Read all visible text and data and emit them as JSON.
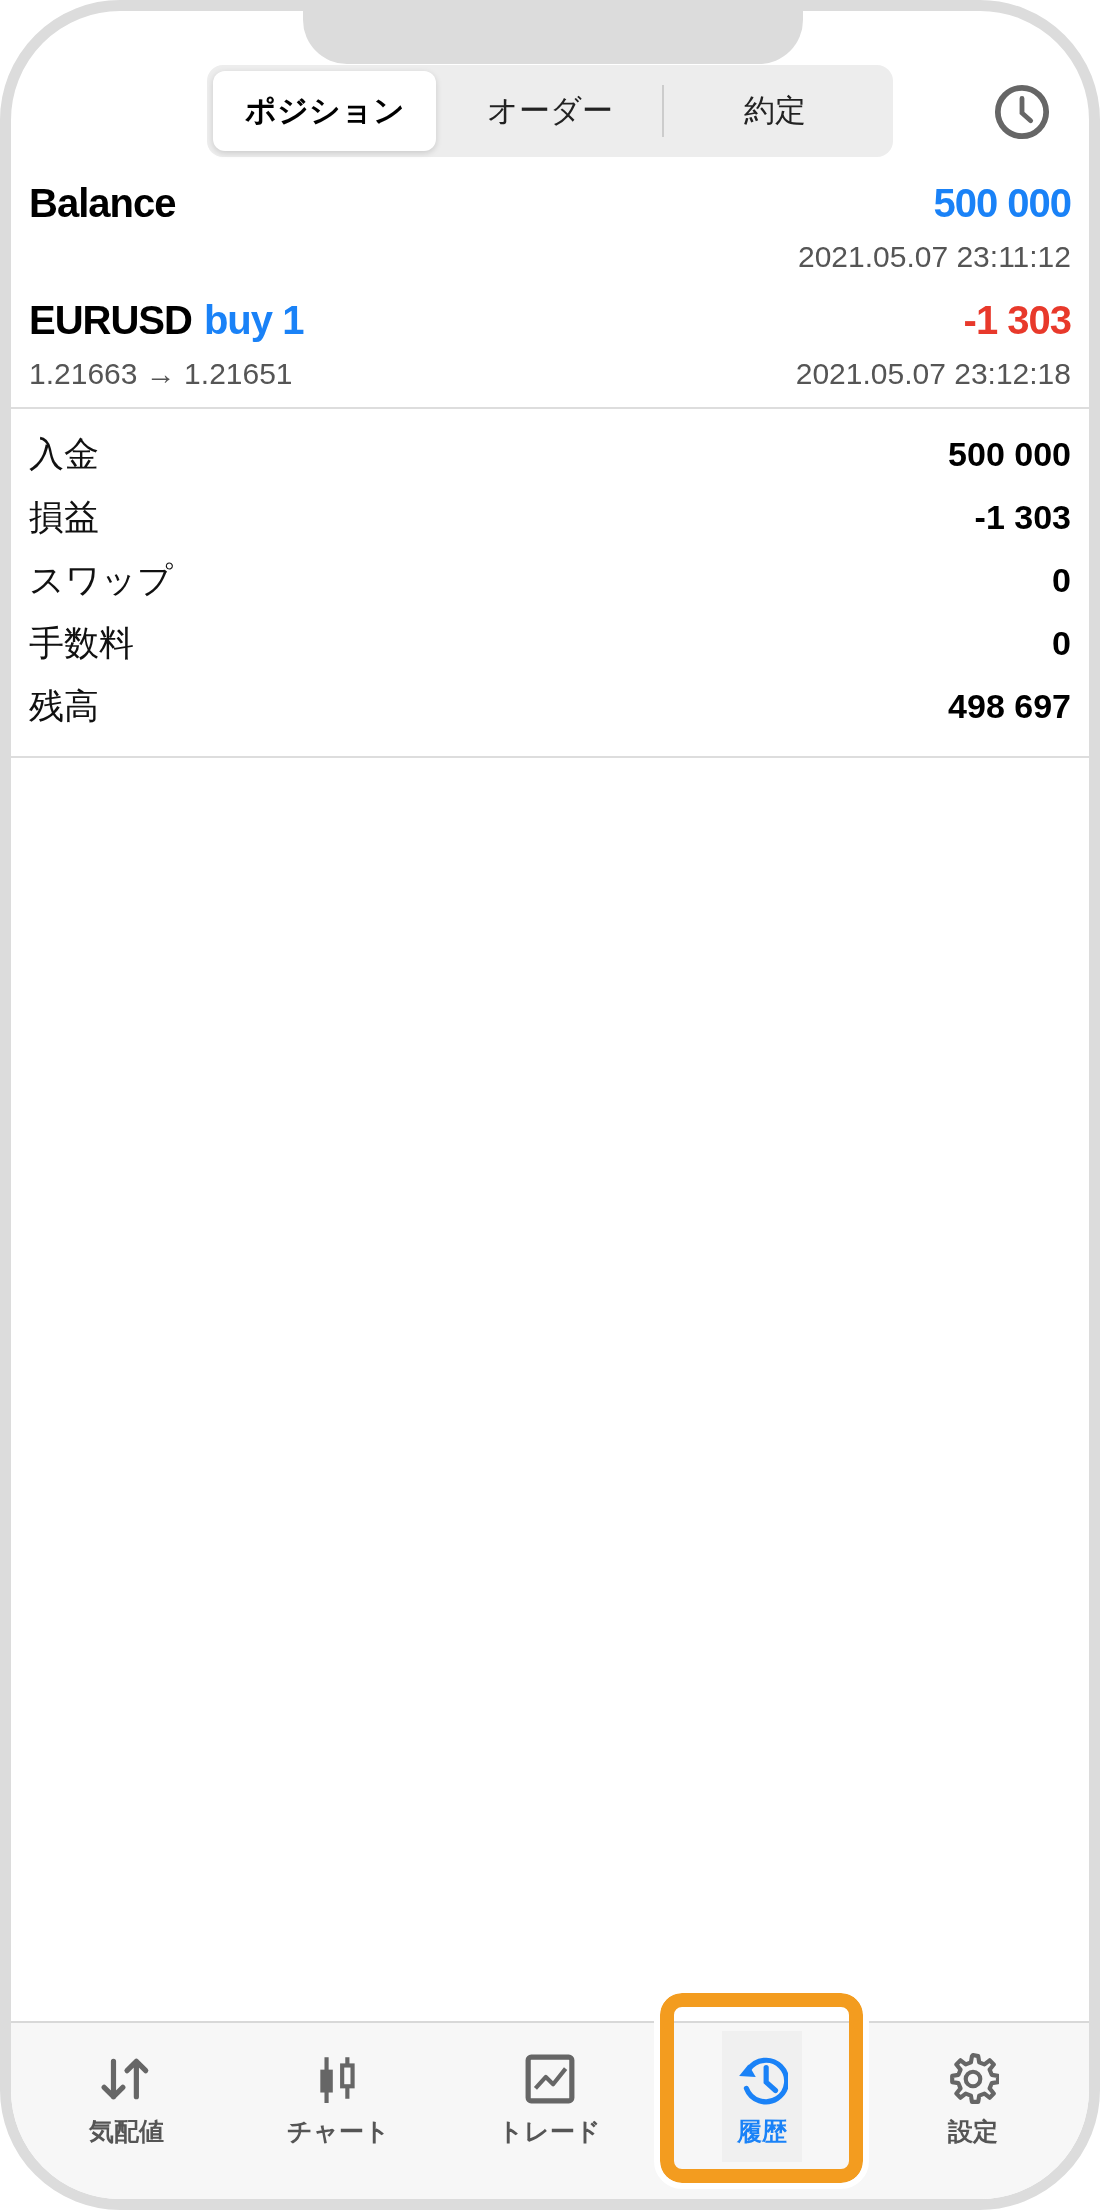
{
  "segments": [
    {
      "label": "ポジション",
      "selected": true
    },
    {
      "label": "オーダー",
      "selected": false
    },
    {
      "label": "約定",
      "selected": false
    }
  ],
  "deals": [
    {
      "symbol": "Balance",
      "amount": "500 000",
      "color": "#1a82f7",
      "time": "2021.05.07 23:11:12"
    },
    {
      "symbol": "EURUSD",
      "side": "buy 1",
      "amount": "-1 303",
      "color": "#e8392b",
      "prices": "1.21663 → 1.21651",
      "time": "2021.05.07 23:12:18"
    }
  ],
  "summary": [
    {
      "label": "入金",
      "value": "500 000"
    },
    {
      "label": "損益",
      "value": "-1 303"
    },
    {
      "label": "スワップ",
      "value": "0"
    },
    {
      "label": "手数料",
      "value": "0"
    },
    {
      "label": "残高",
      "value": "498 697"
    }
  ],
  "tab_bar": [
    {
      "label": "気配値",
      "kind": "arrows",
      "selected": false,
      "highlighted": false
    },
    {
      "label": "チャート",
      "kind": "candles",
      "selected": false,
      "highlighted": false
    },
    {
      "label": "トレード",
      "kind": "chart",
      "selected": false,
      "highlighted": false
    },
    {
      "label": "履歴",
      "kind": "history",
      "selected": true,
      "highlighted": true
    },
    {
      "label": "設定",
      "kind": "gear",
      "selected": false,
      "highlighted": false
    }
  ]
}
